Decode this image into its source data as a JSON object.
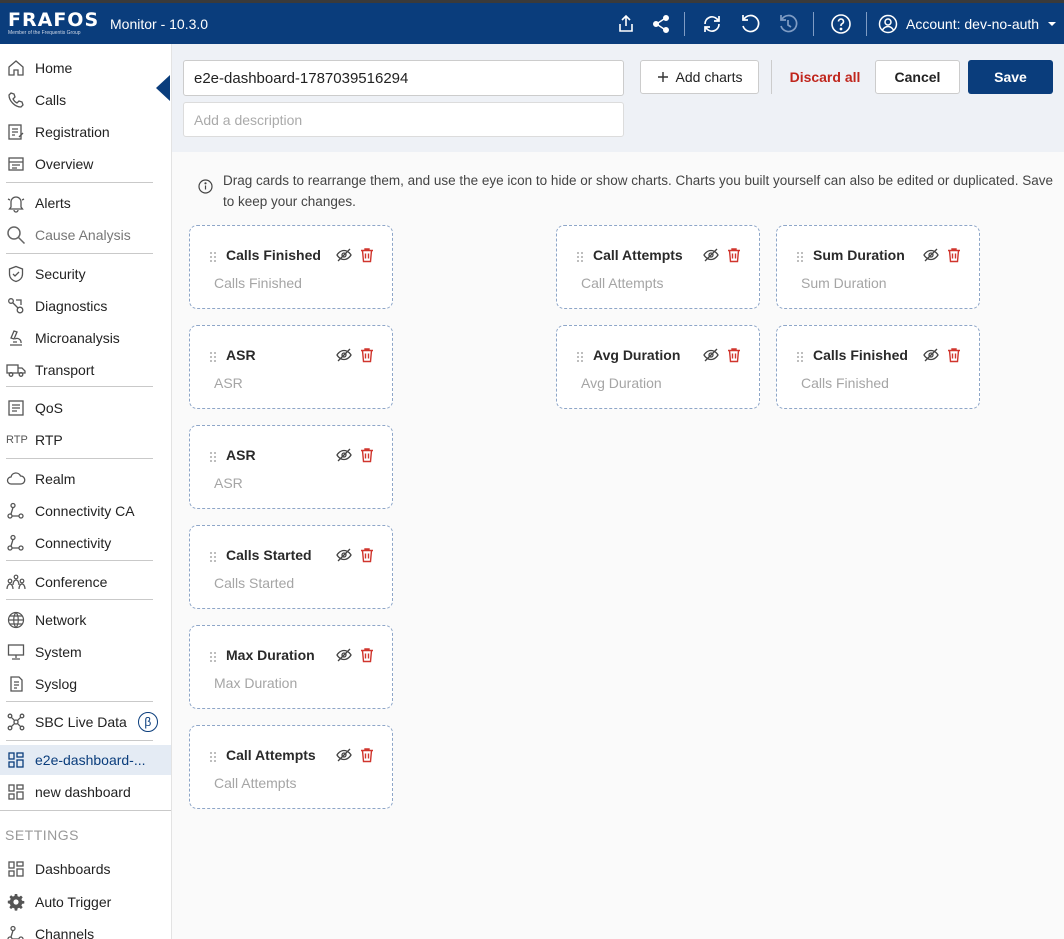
{
  "brand": {
    "name": "FRAFOS",
    "tagline": "Member of the Frequentis Group"
  },
  "app": {
    "title": "Monitor - 10.3.0"
  },
  "account": {
    "label": "Account: dev-no-auth"
  },
  "colors": {
    "primary": "#0a3d7c",
    "danger": "#c0261d",
    "card_border": "#8ea6c8"
  },
  "toolbar_icons": [
    "export-icon",
    "share-icon",
    "sync-icon",
    "refresh-icon",
    "history-icon",
    "help-icon",
    "account-icon",
    "caret-down-icon"
  ],
  "sidebar": {
    "groups": [
      [
        {
          "label": "Home",
          "icon": "home-icon"
        },
        {
          "label": "Calls",
          "icon": "phone-icon"
        },
        {
          "label": "Registration",
          "icon": "registration-icon"
        },
        {
          "label": "Overview",
          "icon": "overview-icon"
        }
      ],
      [
        {
          "label": "Alerts",
          "icon": "bell-icon"
        },
        {
          "label": "Cause Analysis",
          "icon": "search-icon"
        }
      ],
      [
        {
          "label": "Security",
          "icon": "shield-icon"
        },
        {
          "label": "Diagnostics",
          "icon": "diagnostics-icon"
        },
        {
          "label": "Microanalysis",
          "icon": "microscope-icon"
        },
        {
          "label": "Transport",
          "icon": "truck-icon"
        }
      ],
      [
        {
          "label": "QoS",
          "icon": "qos-icon"
        },
        {
          "label": "RTP",
          "icon": "rtp-icon"
        }
      ],
      [
        {
          "label": "Realm",
          "icon": "cloud-icon"
        },
        {
          "label": "Connectivity CA",
          "icon": "connectivity-ca-icon"
        },
        {
          "label": "Connectivity",
          "icon": "connectivity-icon"
        }
      ],
      [
        {
          "label": "Conference",
          "icon": "conference-icon"
        }
      ],
      [
        {
          "label": "Network",
          "icon": "globe-icon"
        },
        {
          "label": "System",
          "icon": "monitor-icon"
        },
        {
          "label": "Syslog",
          "icon": "syslog-icon"
        }
      ],
      [
        {
          "label": "SBC Live Data",
          "icon": "hub-icon",
          "badge": "β"
        }
      ],
      [
        {
          "label": "e2e-dashboard-...",
          "icon": "dashboard-icon",
          "active": true
        },
        {
          "label": "new dashboard",
          "icon": "dashboard-icon"
        }
      ]
    ],
    "settings_label": "SETTINGS",
    "settings_items": [
      {
        "label": "Dashboards",
        "icon": "dashboard-icon"
      },
      {
        "label": "Auto Trigger",
        "icon": "gear-icon"
      },
      {
        "label": "Channels",
        "icon": "channels-icon"
      }
    ]
  },
  "editor": {
    "name_value": "e2e-dashboard-1787039516294",
    "description_placeholder": "Add a description",
    "add_charts_label": "Add charts",
    "discard_label": "Discard all",
    "cancel_label": "Cancel",
    "save_label": "Save",
    "info_text": "Drag cards to rearrange them, and use the eye icon to hide or show charts. Charts you built yourself can also be edited or duplicated. Save to keep your changes."
  },
  "columns": [
    [
      {
        "title": "Calls Finished",
        "subtitle": "Calls Finished"
      },
      {
        "title": "ASR",
        "subtitle": "ASR"
      },
      {
        "title": "ASR",
        "subtitle": "ASR"
      },
      {
        "title": "Calls Started",
        "subtitle": "Calls Started"
      },
      {
        "title": "Max Duration",
        "subtitle": "Max Duration"
      },
      {
        "title": "Call Attempts",
        "subtitle": "Call Attempts"
      }
    ],
    [],
    [
      {
        "title": "Call Attempts",
        "subtitle": "Call Attempts"
      },
      {
        "title": "Avg Duration",
        "subtitle": "Avg Duration"
      }
    ],
    [
      {
        "title": "Sum Duration",
        "subtitle": "Sum Duration"
      },
      {
        "title": "Calls Finished",
        "subtitle": "Calls Finished"
      }
    ]
  ]
}
